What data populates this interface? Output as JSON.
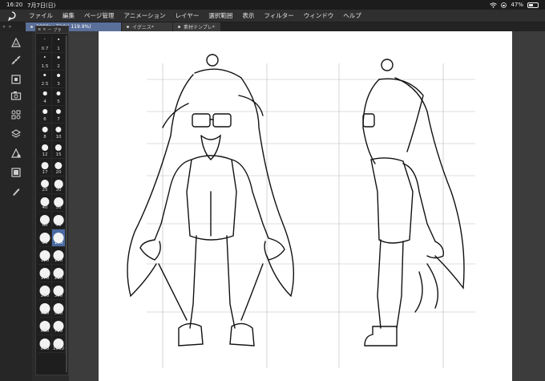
{
  "status": {
    "time": "16:20",
    "date": "7月7日(日)",
    "battery": "47%",
    "battery_level": 0.47
  },
  "menu": {
    "items": [
      "ファイル",
      "編集",
      "ページ管理",
      "アニメーション",
      "レイヤー",
      "選択範囲",
      "表示",
      "フィルター",
      "ウィンドウ",
      "ヘルプ"
    ]
  },
  "tabs": [
    {
      "label": "2000px 72dpi 119.9%)",
      "active": true
    },
    {
      "label": "イグニス*",
      "active": false
    },
    {
      "label": "素材テンプレ*",
      "active": false
    }
  ],
  "brush_panel": {
    "title": "ブラ",
    "sizes": [
      "0.7",
      "1",
      "1.5",
      "2",
      "2.5",
      "3",
      "4",
      "5",
      "6",
      "7",
      "8",
      "10",
      "12",
      "15",
      "17",
      "20",
      "25",
      "30",
      "40",
      "50",
      "60",
      "70",
      "80",
      "100",
      "120",
      "150",
      "170",
      "200",
      "250",
      "300",
      "400",
      "500",
      "600",
      "700",
      "800",
      "1000"
    ],
    "selected": "100"
  },
  "icons": {
    "left_tools": [
      "adjust-layer-icon",
      "ruler-icon",
      "navigator-icon",
      "camera-icon",
      "layer-properties-icon",
      "layers-icon",
      "material-icon",
      "frame-icon",
      "pen-icon"
    ]
  }
}
